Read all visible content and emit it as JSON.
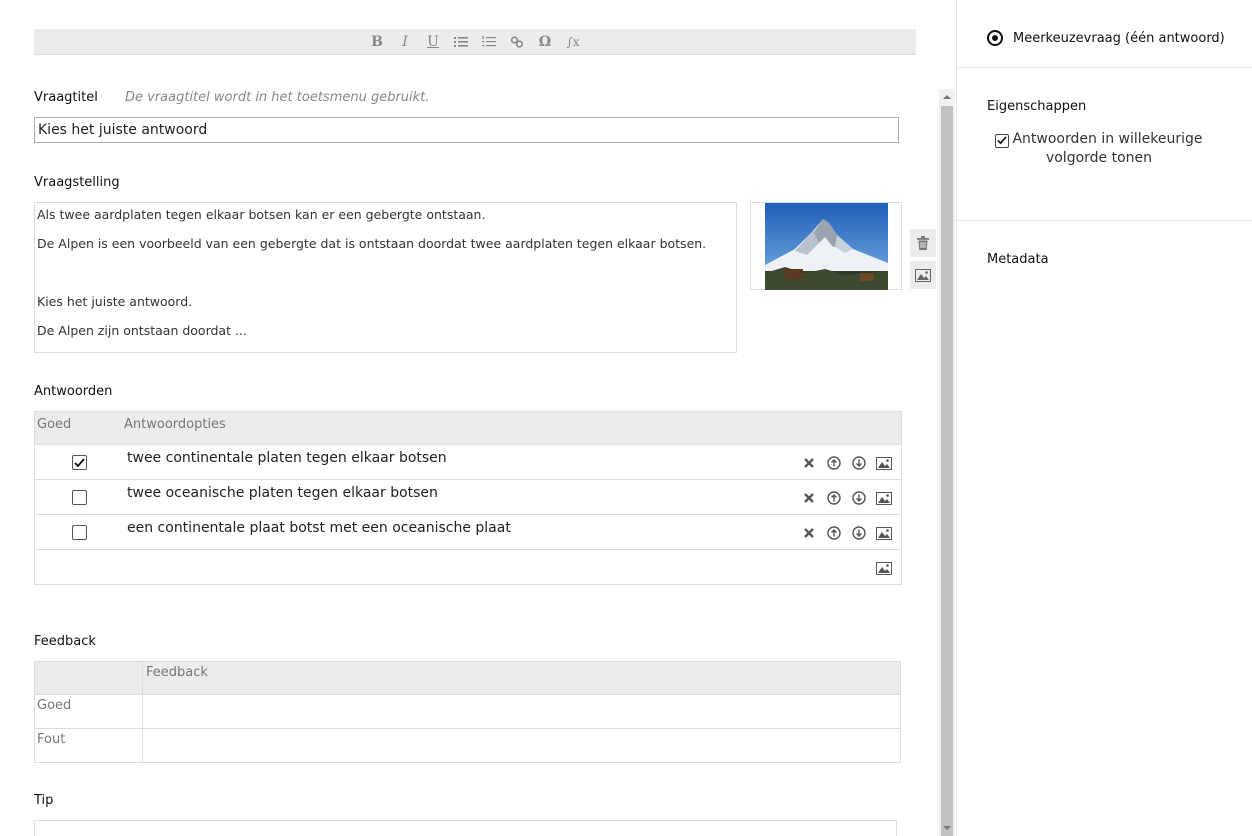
{
  "toolbar": {
    "buttons": [
      {
        "name": "bold",
        "label": "B"
      },
      {
        "name": "italic",
        "label": "I"
      },
      {
        "name": "underline",
        "label": "U"
      },
      {
        "name": "bullet-list",
        "label": ""
      },
      {
        "name": "numbered-list",
        "label": ""
      },
      {
        "name": "link",
        "label": ""
      },
      {
        "name": "special-char",
        "label": "Ω"
      },
      {
        "name": "formula",
        "label": "∫x"
      }
    ]
  },
  "question": {
    "title_label": "Vraagtitel",
    "title_hint": "De vraagtitel wordt in het toetsmenu gebruikt.",
    "title_value": "Kies het juiste antwoord",
    "stem_label": "Vraagstelling",
    "stem_lines": [
      "Als twee aardplaten tegen elkaar botsen kan er een gebergte ontstaan.",
      "De Alpen is een voorbeeld van een gebergte dat is ontstaan doordat twee aardplaten tegen elkaar botsen.",
      "",
      "Kies het juiste antwoord.",
      "De Alpen zijn ontstaan doordat ..."
    ]
  },
  "answers": {
    "label": "Antwoorden",
    "col_correct": "Goed",
    "col_options": "Antwoordopties",
    "rows": [
      {
        "text": "twee continentale platen tegen elkaar botsen",
        "checked": true
      },
      {
        "text": "twee oceanische platen tegen elkaar botsen",
        "checked": false
      },
      {
        "text": "een continentale plaat botst met een oceanische plaat",
        "checked": false
      }
    ]
  },
  "feedback": {
    "label": "Feedback",
    "col_header": "Feedback",
    "rows": [
      {
        "label": "Goed",
        "value": ""
      },
      {
        "label": "Fout",
        "value": ""
      }
    ]
  },
  "tip": {
    "label": "Tip"
  },
  "sidebar": {
    "question_type": "Meerkeuzevraag (één antwoord)",
    "properties_heading": "Eigenschappen",
    "shuffle_option": "Antwoorden in willekeurige volgorde tonen",
    "shuffle_checked": true,
    "metadata_heading": "Metadata"
  },
  "colors": {
    "header_bg": "#ececec",
    "border": "#dddddd",
    "hint": "#888888"
  }
}
